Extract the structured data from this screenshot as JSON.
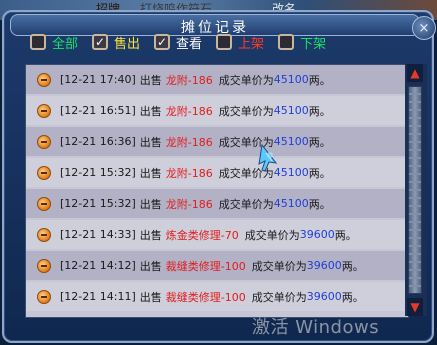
{
  "background": {
    "left_text": "招牌",
    "left_text2": "打烧鸣作符石",
    "right_text": "改名"
  },
  "window": {
    "title": "摊位记录",
    "close": "×"
  },
  "filters": [
    {
      "label": "全部",
      "checked": false,
      "color": "#19e06a"
    },
    {
      "label": "售出",
      "checked": true,
      "color": "#ffe23a"
    },
    {
      "label": "查看",
      "checked": true,
      "color": "#ffffff"
    },
    {
      "label": "上架",
      "checked": false,
      "color": "#ff3a2a"
    },
    {
      "label": "下架",
      "checked": false,
      "color": "#19e06a"
    }
  ],
  "records": [
    {
      "time": "[12-21 17:40]",
      "action": "出售",
      "item": "龙附-186",
      "text": "成交单价为",
      "price": "45100",
      "unit": "两。"
    },
    {
      "time": "[12-21 16:51]",
      "action": "出售",
      "item": "龙附-186",
      "text": "成交单价为",
      "price": "45100",
      "unit": "两。"
    },
    {
      "time": "[12-21 16:36]",
      "action": "出售",
      "item": "龙附-186",
      "text": "成交单价为",
      "price": "45100",
      "unit": "两。"
    },
    {
      "time": "[12-21 15:32]",
      "action": "出售",
      "item": "龙附-186",
      "text": "成交单价为",
      "price": "45100",
      "unit": "两。"
    },
    {
      "time": "[12-21 15:32]",
      "action": "出售",
      "item": "龙附-186",
      "text": "成交单价为",
      "price": "45100",
      "unit": "两。"
    },
    {
      "time": "[12-21 14:33]",
      "action": "出售",
      "item": "炼金类修理-70",
      "text": "成交单价为",
      "price": "39600",
      "unit": "两。"
    },
    {
      "time": "[12-21 14:12]",
      "action": "出售",
      "item": "裁缝类修理-100",
      "text": "成交单价为",
      "price": "39600",
      "unit": "两。"
    },
    {
      "time": "[12-21 14:11]",
      "action": "出售",
      "item": "裁缝类修理-100",
      "text": "成交单价为",
      "price": "39600",
      "unit": "两。"
    }
  ],
  "watermark": "激活 Windows",
  "icons": {
    "bullet": "orange-bullet-icon",
    "scroll_up": "triangle-up-icon",
    "scroll_down": "triangle-down-icon",
    "cursor": "game-cursor-icon"
  }
}
